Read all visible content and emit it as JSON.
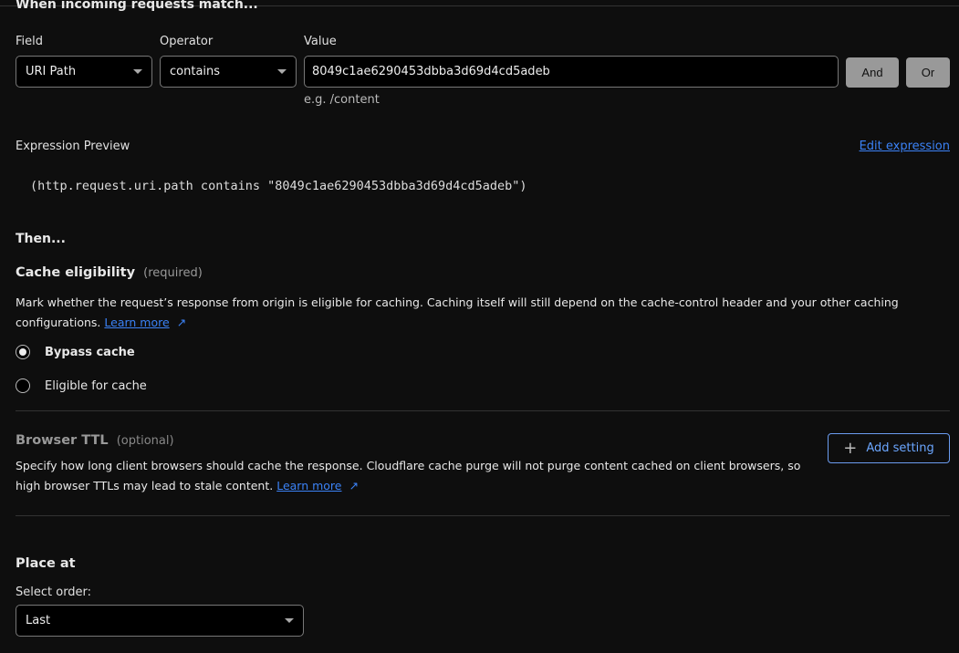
{
  "section_title": "When incoming requests match...",
  "field": {
    "label": "Field",
    "value": "URI Path"
  },
  "operator": {
    "label": "Operator",
    "value": "contains"
  },
  "value": {
    "label": "Value",
    "value": "8049c1ae6290453dbba3d69d4cd5adeb",
    "hint": "e.g. /content"
  },
  "buttons": {
    "and": "And",
    "or": "Or",
    "add_setting": "Add setting"
  },
  "expression": {
    "label": "Expression Preview",
    "edit_link": "Edit expression",
    "text": "(http.request.uri.path contains \"8049c1ae6290453dbba3d69d4cd5adeb\")"
  },
  "then_title": "Then...",
  "cache_eligibility": {
    "title": "Cache eligibility",
    "tag": "(required)",
    "description": "Mark whether the request’s response from origin is eligible for caching. Caching itself will still depend on the cache-control header and your other caching configurations.",
    "learn_more": "Learn more",
    "options": [
      {
        "label": "Bypass cache",
        "selected": true
      },
      {
        "label": "Eligible for cache",
        "selected": false
      }
    ]
  },
  "browser_ttl": {
    "title": "Browser TTL",
    "tag": "(optional)",
    "description": "Specify how long client browsers should cache the response. Cloudflare cache purge will not purge content cached on client browsers, so high browser TTLs may lead to stale content.",
    "learn_more": "Learn more"
  },
  "place_at": {
    "title": "Place at",
    "order_label": "Select order:",
    "order_value": "Last"
  }
}
